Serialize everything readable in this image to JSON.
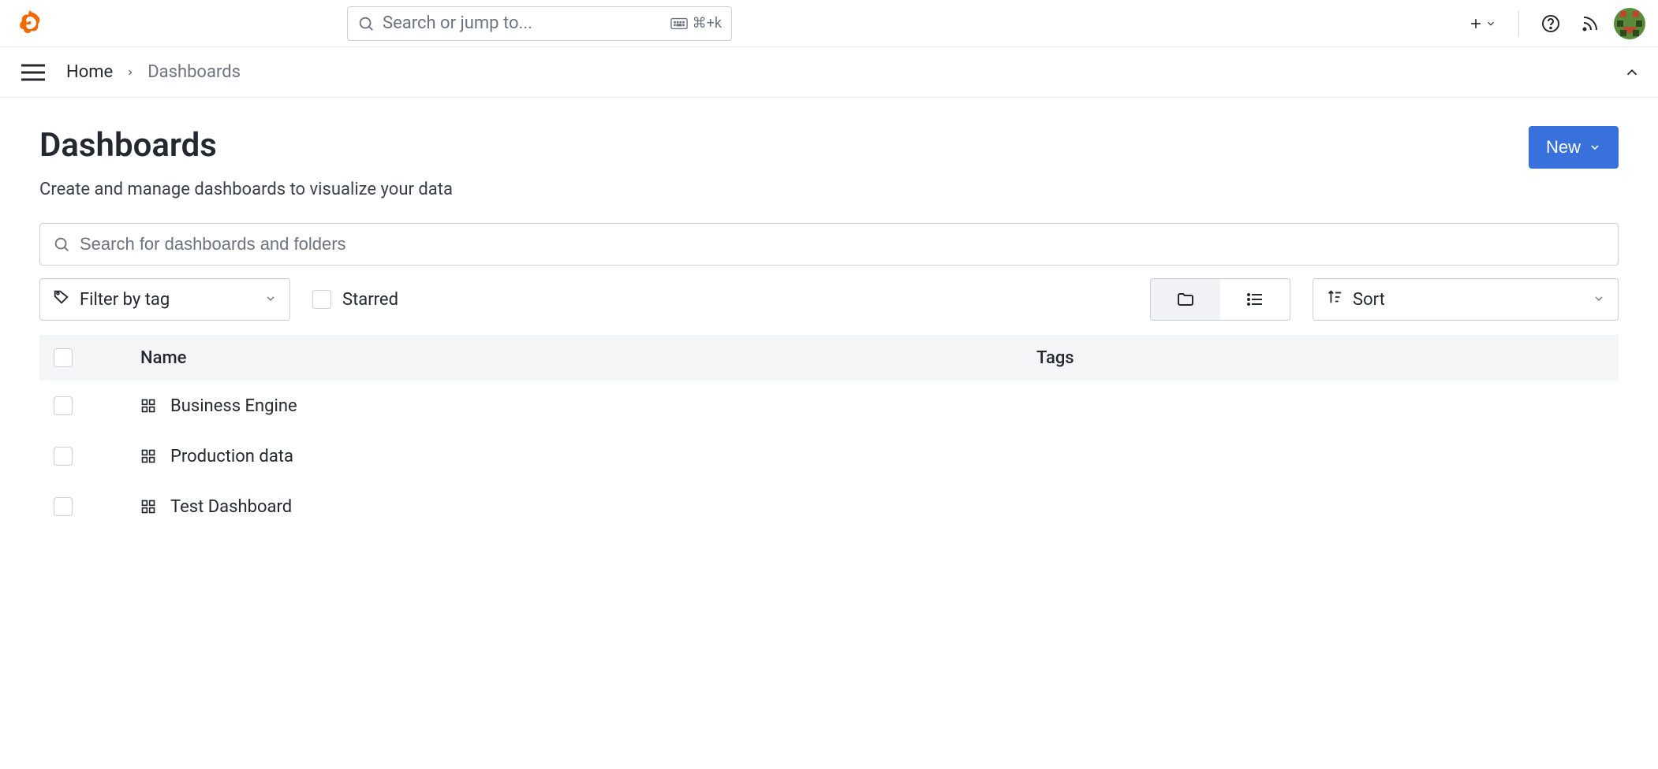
{
  "header": {
    "search_placeholder": "Search or jump to...",
    "shortcut": "⌘+k"
  },
  "breadcrumb": {
    "home": "Home",
    "current": "Dashboards"
  },
  "page": {
    "title": "Dashboards",
    "subtitle": "Create and manage dashboards to visualize your data",
    "new_button": "New"
  },
  "search": {
    "placeholder": "Search for dashboards and folders"
  },
  "filters": {
    "tag_label": "Filter by tag",
    "starred_label": "Starred",
    "sort_label": "Sort"
  },
  "table": {
    "columns": {
      "name": "Name",
      "tags": "Tags"
    },
    "rows": [
      {
        "name": "Business Engine"
      },
      {
        "name": "Production data"
      },
      {
        "name": "Test Dashboard"
      }
    ]
  }
}
